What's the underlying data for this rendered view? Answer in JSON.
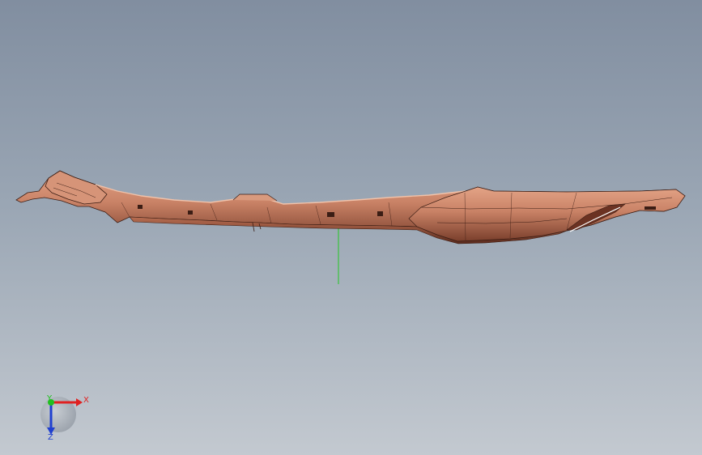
{
  "viewport": {
    "background_top": "#818ea0",
    "background_bottom": "#c3c9d0"
  },
  "model": {
    "icon": "trim-panel-3d-model",
    "color": "#c98266",
    "edge_color": "#3b1d14"
  },
  "triad": {
    "x_label": "X",
    "y_label": "Y",
    "z_label": "Z",
    "x_color": "#e02020",
    "y_color": "#20c020",
    "z_color": "#2040d0"
  }
}
